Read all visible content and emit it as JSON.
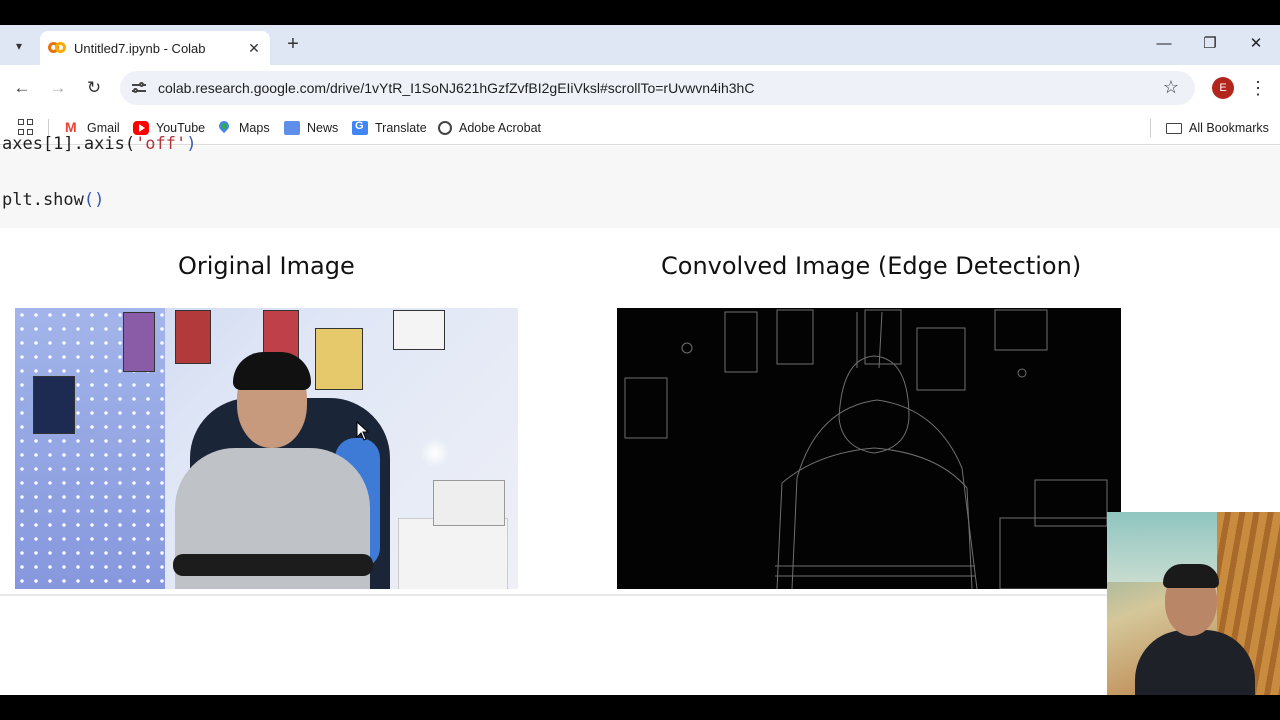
{
  "browser": {
    "tab": {
      "title": "Untitled7.ipynb - Colab"
    },
    "url": "colab.research.google.com/drive/1vYtR_I1SoNJ621hGzfZvfBI2gEIiVksl#scrollTo=rUvwvn4ih3hC",
    "profile_initial": "E",
    "bookmarks": [
      {
        "label": "Gmail",
        "icon": "gmail-icon"
      },
      {
        "label": "YouTube",
        "icon": "youtube-icon"
      },
      {
        "label": "Maps",
        "icon": "maps-icon"
      },
      {
        "label": "News",
        "icon": "news-icon"
      },
      {
        "label": "Translate",
        "icon": "translate-icon"
      },
      {
        "label": "Adobe Acrobat",
        "icon": "globe-icon"
      }
    ],
    "all_bookmarks": "All Bookmarks"
  },
  "notebook": {
    "code_lines": {
      "line1_pre": "axes[1].axis(",
      "line1_str": "'off'",
      "line1_post": ")",
      "line2_pre": "plt.show",
      "line2_paren": "()"
    },
    "output": {
      "left_title": "Original Image",
      "right_title": "Convolved Image (Edge Detection)"
    }
  },
  "colors": {
    "tab_strip": "#dfe7f5",
    "omnibox": "#eef2f8",
    "profile": "#b3261e"
  }
}
